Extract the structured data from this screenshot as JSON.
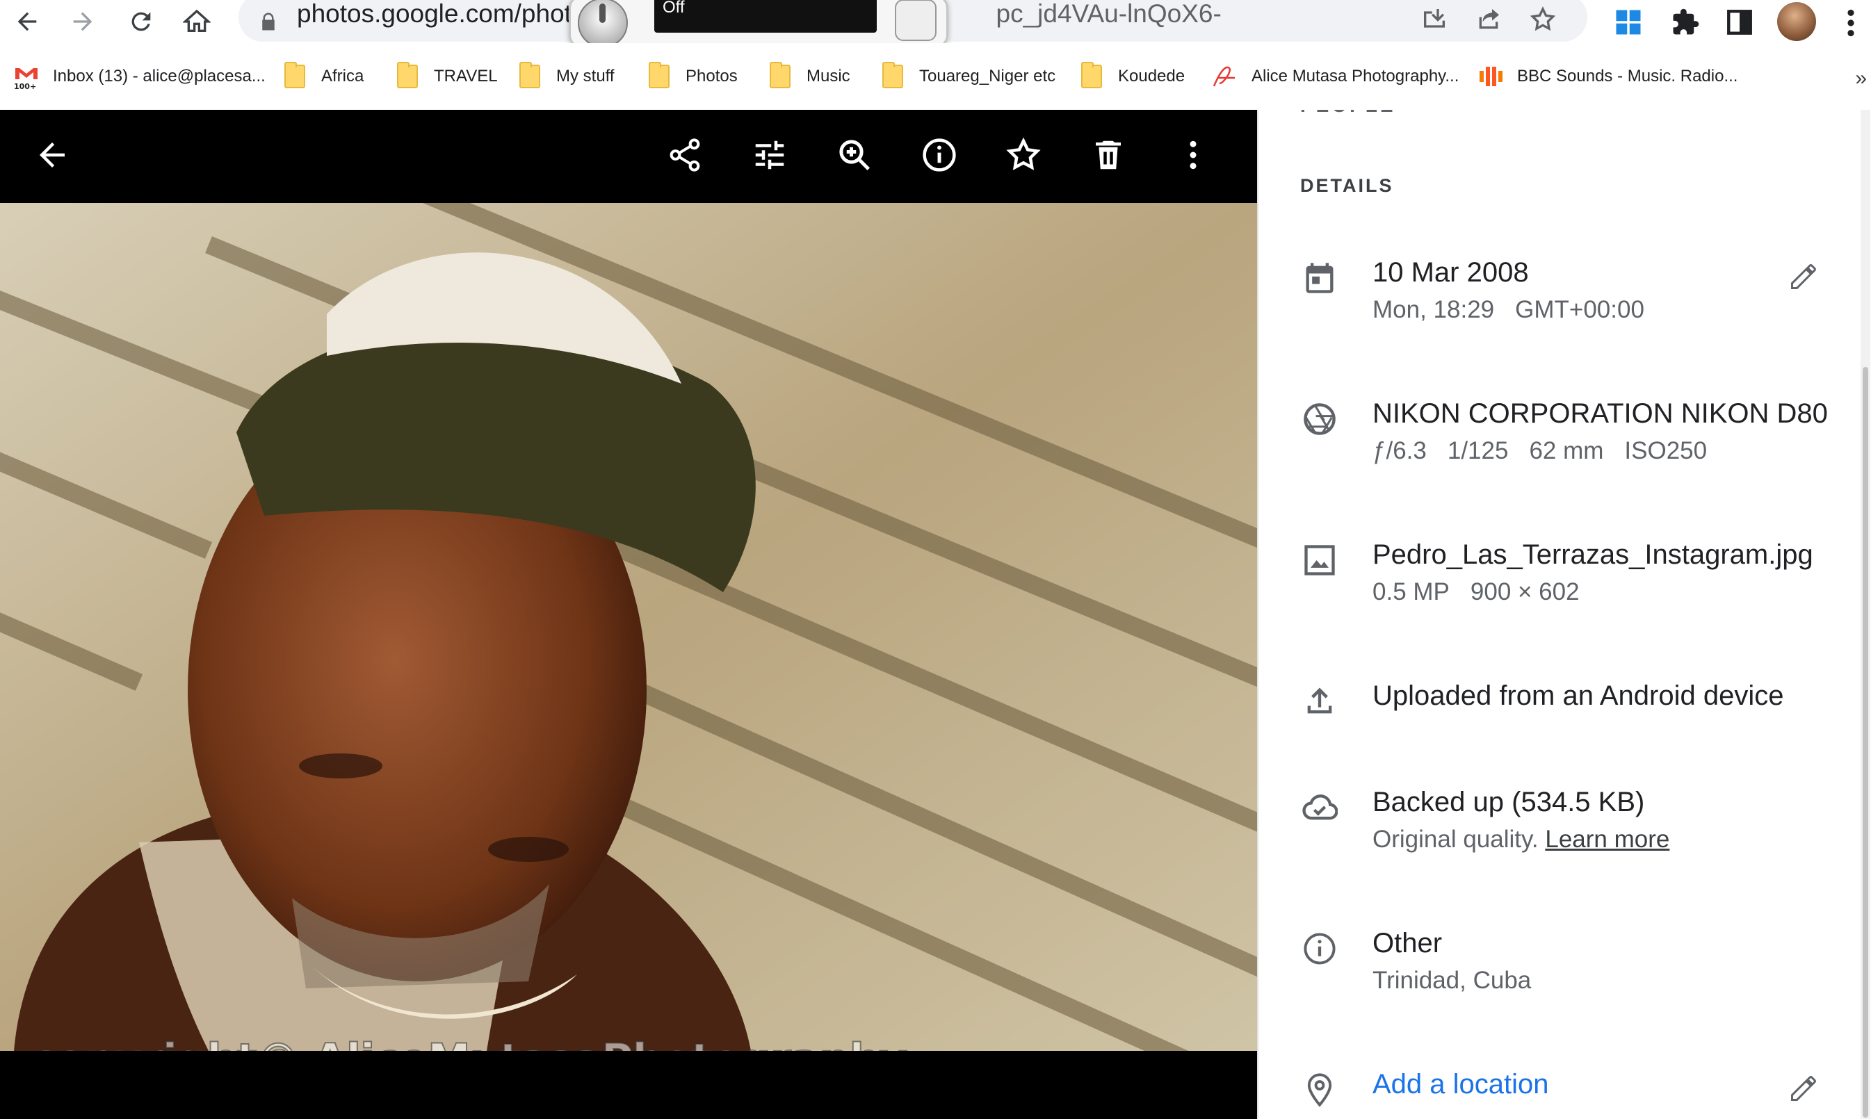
{
  "browser": {
    "url_visible": "photos.google.com/photo",
    "url_tail": "pc_jd4VAu-lnQoX6-",
    "overlay_status": "Off"
  },
  "bookmarks": [
    {
      "label": "Inbox (13) - alice@placesa...",
      "icon": "gmail-icon"
    },
    {
      "label": "Africa",
      "icon": "folder-icon"
    },
    {
      "label": "TRAVEL",
      "icon": "folder-icon"
    },
    {
      "label": "My stuff",
      "icon": "folder-icon"
    },
    {
      "label": "Photos",
      "icon": "folder-icon"
    },
    {
      "label": "Music",
      "icon": "folder-icon"
    },
    {
      "label": "Touareg_Niger etc",
      "icon": "folder-icon"
    },
    {
      "label": "Koudede",
      "icon": "folder-icon"
    },
    {
      "label": "Alice Mutasa Photography...",
      "icon": "signature-icon"
    },
    {
      "label": "BBC Sounds - Music. Radio...",
      "icon": "bbc-sounds-icon"
    }
  ],
  "bookmarks_more": "»",
  "gmail_badge": "100+",
  "photo": {
    "watermark": "copyright© AliceMutasaPhotography"
  },
  "panel": {
    "people_heading_partial": "PEOPLE",
    "details_heading": "DETAILS",
    "date": {
      "primary": "10 Mar 2008",
      "time": "Mon, 18:29",
      "timezone": "GMT+00:00"
    },
    "camera": {
      "primary": "NIKON CORPORATION NIKON D80",
      "aperture": "ƒ/6.3",
      "shutter": "1/125",
      "focal": "62 mm",
      "iso": "ISO250"
    },
    "file": {
      "primary": "Pedro_Las_Terrazas_Instagram.jpg",
      "megapixels": "0.5 MP",
      "dimensions": "900 × 602"
    },
    "upload": {
      "primary": "Uploaded from an Android device"
    },
    "backup": {
      "primary": "Backed up (534.5 KB)",
      "quality": "Original quality.",
      "learn_more": "Learn more"
    },
    "other": {
      "primary": "Other",
      "place": "Trinidad, Cuba"
    },
    "location": {
      "primary": "Add a location"
    }
  },
  "colors": {
    "link_blue": "#1a73e8",
    "viewer_bg": "#000000",
    "panel_bg": "#ffffff"
  }
}
